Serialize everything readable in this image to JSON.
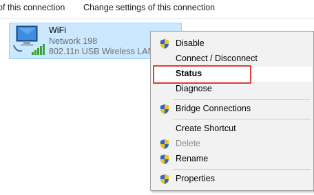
{
  "toolbar": {
    "item1": "of this connection",
    "item2": "Change settings of this connection"
  },
  "adapter": {
    "name": "WiFi",
    "network": "Network 198",
    "device": "802.11n USB Wireless LAN C",
    "icon": "wifi-adapter-icon"
  },
  "menu": {
    "items": [
      {
        "label": "Disable",
        "shield": true
      },
      {
        "label": "Connect / Disconnect",
        "shield": false
      },
      {
        "label": "Status",
        "shield": false,
        "default": true
      },
      {
        "label": "Diagnose",
        "shield": false
      },
      {
        "label": "Bridge Connections",
        "shield": true
      },
      {
        "label": "Create Shortcut",
        "shield": false
      },
      {
        "label": "Delete",
        "shield": true,
        "disabled": true
      },
      {
        "label": "Rename",
        "shield": true
      },
      {
        "label": "Properties",
        "shield": true
      }
    ]
  },
  "colors": {
    "highlight": "#e23a3a",
    "selection": "#cce8ff"
  }
}
